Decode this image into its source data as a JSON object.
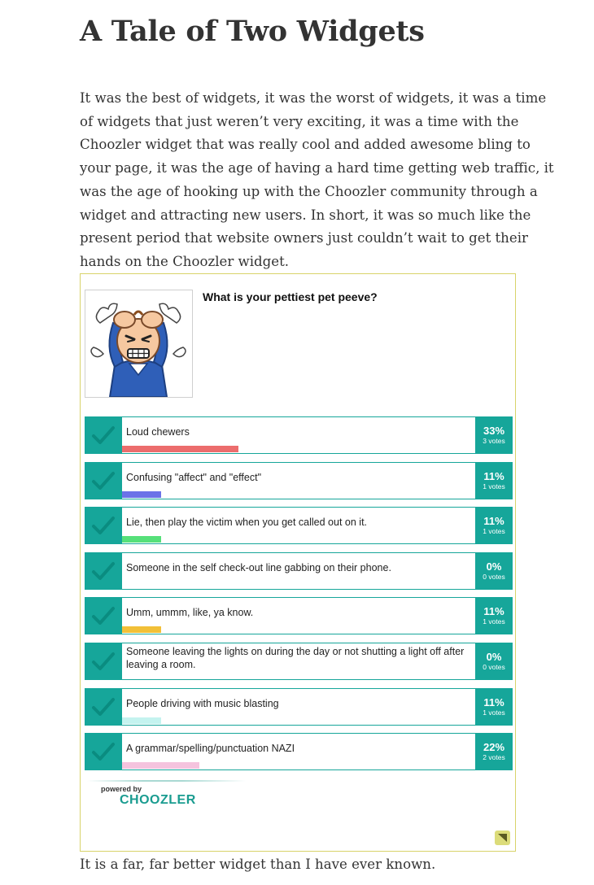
{
  "article": {
    "title": "A Tale of Two Widgets",
    "intro": "It was the best of widgets, it was the worst of widgets, it was a time of widgets that just weren’t very exciting, it was a time with the Choozler widget that was really cool and added awesome bling to your page, it was the age of having a hard time getting web traffic, it was the age of hooking up with the Choozler community through a widget and attract­ing new users. In short, it was so much like the present period that web­site owners just couldn’t wait to get their hands on the Choozler widget.",
    "outro": "It is a far, far better widget than I have ever known."
  },
  "poll": {
    "question": "What is your pettiest pet peeve?",
    "options": [
      {
        "label": "Loud chewers",
        "percent": "33%",
        "votes": "3 votes",
        "share": 0.33,
        "bar_color": "#ec6d6d"
      },
      {
        "label": "Confusing \"affect\" and \"effect\"",
        "percent": "11%",
        "votes": "1 votes",
        "share": 0.11,
        "bar_color": "#6b72e8"
      },
      {
        "label": "Lie, then play the victim when you get called out on it.",
        "percent": "11%",
        "votes": "1 votes",
        "share": 0.11,
        "bar_color": "#56e07a"
      },
      {
        "label": "Someone in the self check-out line gabbing on their phone.",
        "percent": "0%",
        "votes": "0 votes",
        "share": 0,
        "bar_color": "#cccccc"
      },
      {
        "label": "Umm, ummm, like, ya know.",
        "percent": "11%",
        "votes": "1 votes",
        "share": 0.11,
        "bar_color": "#f2c038"
      },
      {
        "label": "Someone leaving the lights on during the day or not shutting a light off after leaving a room.",
        "percent": "0%",
        "votes": "0 votes",
        "share": 0,
        "bar_color": "#cccccc"
      },
      {
        "label": "People driving with music blasting",
        "percent": "11%",
        "votes": "1 votes",
        "share": 0.11,
        "bar_color": "#c4f3ef"
      },
      {
        "label": "A grammar/spelling/punctuation NAZI",
        "percent": "22%",
        "votes": "2 votes",
        "share": 0.22,
        "bar_color": "#f5c3de"
      }
    ],
    "powered_by": "powered by",
    "brand": "CHOOZLER"
  },
  "colors": {
    "teal": "#16a69a",
    "teal_dark": "#0f8b81",
    "check": "#0a8c80",
    "widget_border": "#d8d36a",
    "corner_button": "#dcdc7a",
    "brand": "#1a9c90"
  },
  "icons": {
    "check": "check-icon",
    "corner": "resize-corner-icon",
    "avatar": "frustrated-man-icon"
  }
}
